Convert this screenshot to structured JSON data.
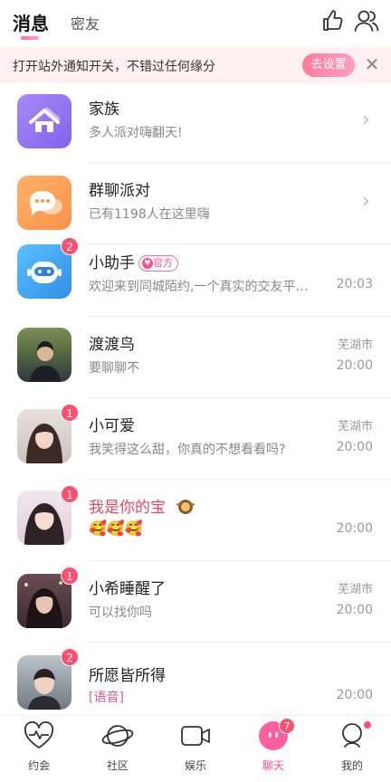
{
  "header": {
    "tab_active": "消息",
    "tab_inactive": "密友",
    "like_icon": "thumbs-up-icon",
    "friends_icon": "users-icon"
  },
  "banner": {
    "text": "打开站外通知开关，不错过任何缘分",
    "button": "去设置",
    "close": "✕"
  },
  "conversations": [
    {
      "name": "家族",
      "preview": "多人派对嗨翻天!",
      "icon": "home-icon",
      "accent": "#9a7cf2"
    },
    {
      "name": "群聊派对",
      "preview": "已有1198人在这里嗨",
      "icon": "chat-bubble-icon",
      "accent": "#ffa45c"
    },
    {
      "name": "小助手",
      "official": "官方",
      "preview": "欢迎来到同城陌约,一个真实的交友平…",
      "time": "20:03",
      "badge": "2",
      "icon": "robot-icon",
      "accent": "#3aa4f2"
    },
    {
      "name": "渡渡鸟",
      "preview": "要聊聊不",
      "city": "芜湖市",
      "time": "20:00"
    },
    {
      "name": "小可爱",
      "preview": "我笑得这么甜，你真的不想看看吗?",
      "city": "芜湖市",
      "time": "20:00",
      "badge": "1"
    },
    {
      "name": "我是你的宝",
      "preview": "🥰🥰🥰",
      "time": "20:00",
      "badge": "1"
    },
    {
      "name": "小希睡醒了",
      "preview": "可以找你吗",
      "city": "芜湖市",
      "time": "20:00",
      "badge": "1"
    },
    {
      "name": "所愿皆所得",
      "preview": "[语音]",
      "time": "20:00",
      "badge": "2"
    }
  ],
  "bottom_nav": [
    {
      "label": "约会",
      "icon": "heart-pulse-icon"
    },
    {
      "label": "社区",
      "icon": "planet-icon"
    },
    {
      "label": "娱乐",
      "icon": "video-icon"
    },
    {
      "label": "聊天",
      "icon": "chat-icon",
      "badge": "7",
      "active": true
    },
    {
      "label": "我的",
      "icon": "profile-icon"
    }
  ],
  "colors": {
    "accent": "#ff4f8b",
    "badge": "#ff4f6e",
    "banner_bg": "#fff0f4"
  }
}
